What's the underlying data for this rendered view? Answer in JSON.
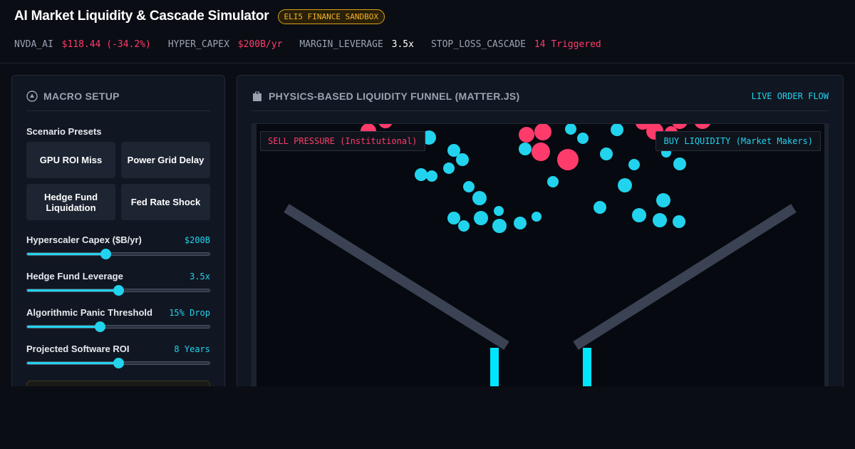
{
  "app": {
    "title": "AI Market Liquidity & Cascade Simulator",
    "badge": "ELI5 FINANCE SANDBOX"
  },
  "ticker": [
    {
      "key": "NVDA_AI",
      "value": "$118.44 (-34.2%)",
      "color": "#ff3b6b"
    },
    {
      "key": "HYPER_CAPEX",
      "value": "$200B/yr",
      "color": "#ff3b6b"
    },
    {
      "key": "MARGIN_LEVERAGE",
      "value": "3.5x",
      "color": "#ffffff"
    },
    {
      "key": "STOP_LOSS_CASCADE",
      "value": "14 Triggered",
      "color": "#ff3b6b"
    }
  ],
  "macro": {
    "heading": "MACRO SETUP",
    "presets_label": "Scenario Presets",
    "presets": [
      "GPU ROI Miss",
      "Power Grid Delay",
      "Hedge Fund Liquidation",
      "Fed Rate Shock"
    ],
    "sliders": [
      {
        "label": "Hyperscaler Capex ($B/yr)",
        "value_text": "$200B",
        "fraction": 0.43
      },
      {
        "label": "Hedge Fund Leverage",
        "value_text": "3.5x",
        "fraction": 0.5
      },
      {
        "label": "Algorithmic Panic Threshold",
        "value_text": "15% Drop",
        "fraction": 0.4
      },
      {
        "label": "Projected Software ROI",
        "value_text": "8 Years",
        "fraction": 0.5
      }
    ]
  },
  "funnel": {
    "heading": "PHYSICS-BASED LIQUIDITY FUNNEL (MATTER.JS)",
    "live_label": "LIVE ORDER FLOW",
    "sell_label": "SELL PRESSURE (Institutional)",
    "buy_label": "BUY LIQUIDITY (Market Makers)"
  },
  "colors": {
    "accent": "#22d3ee",
    "sell": "#ff3b6b",
    "warning": "#f0b429"
  }
}
